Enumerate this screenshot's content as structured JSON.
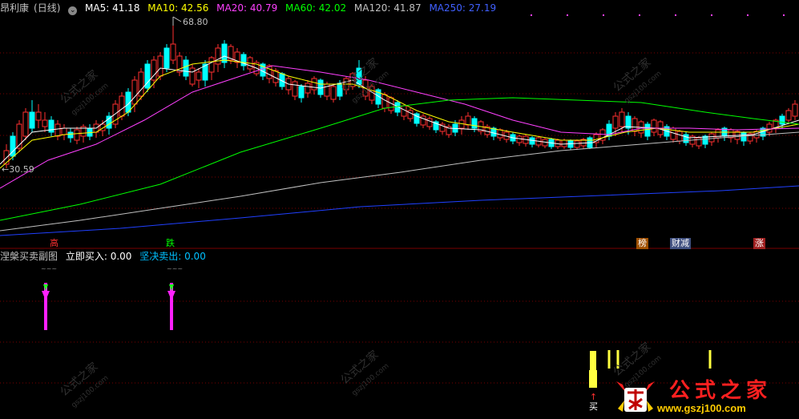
{
  "header": {
    "stock_name": "昂利康",
    "period": "(日线)",
    "ma": [
      {
        "label": "MA5: 41.18",
        "color": "#ffffff"
      },
      {
        "label": "MA10: 42.56",
        "color": "#ffff00"
      },
      {
        "label": "MA20: 40.79",
        "color": "#ff40ff"
      },
      {
        "label": "MA60: 42.02",
        "color": "#00ff00"
      },
      {
        "label": "MA120: 41.87",
        "color": "#c0c0c0"
      },
      {
        "label": "MA250: 27.19",
        "color": "#4060ff"
      }
    ]
  },
  "price_annotations": {
    "high": "68.80",
    "low": "30.59"
  },
  "markers": [
    {
      "text": "高",
      "color": "#ff3030",
      "bg": "transparent"
    },
    {
      "text": "跌",
      "color": "#00ff00",
      "bg": "transparent"
    },
    {
      "text": "榜",
      "color": "#ffffff",
      "bg": "#a05000"
    },
    {
      "text": "财减",
      "color": "#ffffff",
      "bg": "#405080"
    },
    {
      "text": "涨",
      "color": "#ffffff",
      "bg": "#a02020"
    }
  ],
  "sub_panel": {
    "title": "涅槃买卖副图",
    "buy_label": "立即买入: 0.00",
    "sell_label": "坚决卖出: 0.00",
    "buy_color": "#ffffff",
    "sell_color": "#00c0ff",
    "buy_sign": "买"
  },
  "watermark": {
    "logo_text": "公式之家",
    "url_text": "www.gszj100.com",
    "wm_text": "公式之家",
    "wm_url": "gszj100.com"
  },
  "colors": {
    "up": "#ff3030",
    "down": "#00ffff",
    "up_fill": "#000000",
    "grid": "#7a0000",
    "separator": "#7a0000"
  }
}
